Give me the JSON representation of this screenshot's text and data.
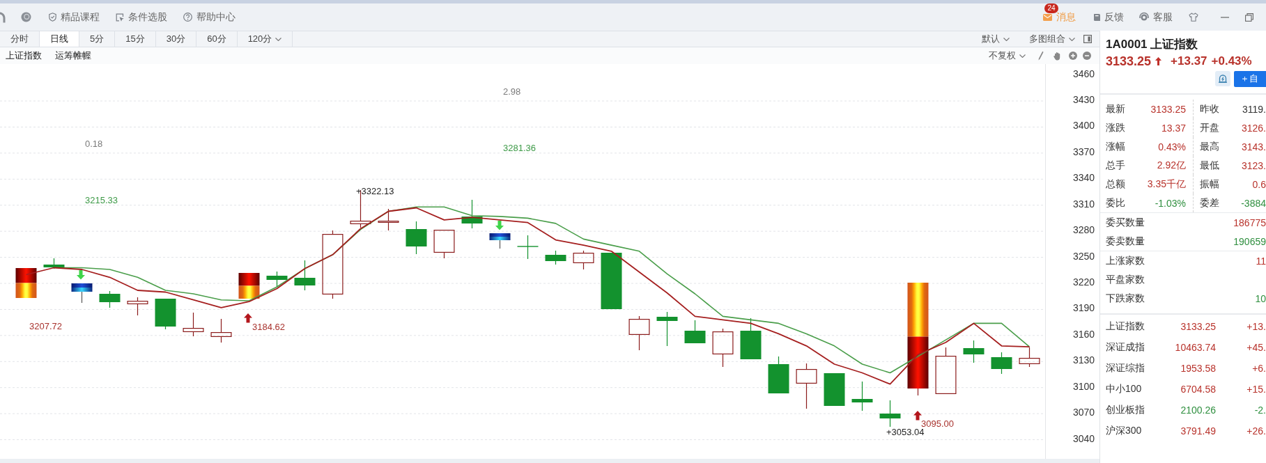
{
  "title_bar": {
    "links": [
      {
        "label": "精品课程"
      },
      {
        "label": "条件选股"
      },
      {
        "label": "帮助中心"
      }
    ],
    "messages": {
      "label": "消息",
      "badge": "24"
    },
    "actions": [
      {
        "label": "反馈"
      },
      {
        "label": "客服"
      }
    ]
  },
  "period_tabs": [
    {
      "label": "分时",
      "selected": false,
      "kind": "tab"
    },
    {
      "label": "日线",
      "selected": true,
      "kind": "tab"
    },
    {
      "label": "5分",
      "selected": false,
      "kind": "tab"
    },
    {
      "label": "15分",
      "selected": false,
      "kind": "tab"
    },
    {
      "label": "30分",
      "selected": false,
      "kind": "tab"
    },
    {
      "label": "60分",
      "selected": false,
      "kind": "tab"
    },
    {
      "label": "120分",
      "selected": false,
      "kind": "dropdown"
    }
  ],
  "view_options": [
    {
      "label": "默认"
    },
    {
      "label": "多图组合"
    }
  ],
  "indicator_bar": {
    "labels": [
      "上证指数",
      "运筹帷幄"
    ],
    "adjustment": "不复权"
  },
  "chart": {
    "chart_data": {
      "type": "line",
      "ylim": [
        3018,
        3472.5
      ],
      "yticks": [
        3460,
        3430,
        3400,
        3370,
        3340,
        3310,
        3280,
        3250,
        3220,
        3190,
        3160,
        3130,
        3100,
        3070,
        3040
      ],
      "grid": true,
      "series": [
        {
          "color": "#a51f1f",
          "values": [
            3230,
            3238,
            3236,
            3227,
            3212,
            3210,
            3201,
            3192,
            3199,
            3214,
            3237,
            3253,
            3283,
            3303,
            3307,
            3293,
            3296,
            3293,
            3290,
            3270,
            3264,
            3257,
            3233,
            3209,
            3182,
            3178,
            3174,
            3162,
            3148,
            3127,
            3117,
            3104,
            3138,
            3152,
            3174,
            3148,
            3147
          ]
        },
        {
          "color": "#4a9e4a",
          "values": [
            null,
            3238,
            3238,
            3236,
            3227,
            3212,
            3208,
            3201,
            3200,
            3216,
            3237,
            3253,
            3282,
            3303,
            3308,
            3308,
            3298,
            3297,
            3295,
            3289,
            3271,
            3264,
            3257,
            3231,
            3208,
            3182,
            3178,
            3174,
            3162,
            3148,
            3127,
            3117,
            3136,
            3155,
            3174,
            3174,
            3147
          ]
        }
      ]
    },
    "labels": [
      {
        "text": "2.98",
        "kind": "indicator"
      },
      {
        "text": "0.18",
        "kind": "indicator"
      },
      {
        "text": "3281.36",
        "kind": "level"
      },
      {
        "text": "+3322.13",
        "kind": "extreme"
      },
      {
        "text": "3215.33",
        "kind": "level"
      },
      {
        "text": "3207.72",
        "kind": "signal"
      },
      {
        "text": "3184.62",
        "kind": "signal"
      },
      {
        "text": "3095.00",
        "kind": "signal"
      },
      {
        "text": "+3053.04",
        "kind": "extreme"
      }
    ]
  },
  "quote_panel": {
    "title": "1A0001 上证指数",
    "price": "3133.25",
    "rising": true,
    "change": "+13.37",
    "change_percent": "+0.43%",
    "add_button": "＋自",
    "stats": [
      {
        "label": "最新",
        "value": "3133.25",
        "color": "#b8322b"
      },
      {
        "label": "昨收",
        "value": "3119.",
        "color": "#333333"
      },
      {
        "label": "涨跌",
        "value": "13.37",
        "color": "#b8322b"
      },
      {
        "label": "开盘",
        "value": "3126.",
        "color": "#b8322b"
      },
      {
        "label": "涨幅",
        "value": "0.43%",
        "color": "#b8322b"
      },
      {
        "label": "最高",
        "value": "3143.",
        "color": "#b8322b"
      },
      {
        "label": "总手",
        "value": "2.92亿",
        "color": "#b8322b"
      },
      {
        "label": "最低",
        "value": "3123.",
        "color": "#b8322b"
      },
      {
        "label": "总额",
        "value": "3.35千亿",
        "color": "#b8322b"
      },
      {
        "label": "振幅",
        "value": "0.6",
        "color": "#b8322b"
      },
      {
        "label": "委比",
        "value": "-1.03%",
        "color": "#2f8f3f"
      },
      {
        "label": "委差",
        "value": "-3884",
        "color": "#2f8f3f"
      }
    ],
    "orders": [
      {
        "label": "委买数量",
        "value": "186775",
        "color": "#b8322b"
      },
      {
        "label": "委卖数量",
        "value": "190659",
        "color": "#2f8f3f"
      }
    ],
    "breadth": [
      {
        "label": "上涨家数",
        "value": "11",
        "color": "#b8322b"
      },
      {
        "label": "平盘家数"
      },
      {
        "label": "下跌家数",
        "value": "10",
        "color": "#2f8f3f"
      }
    ],
    "indices": [
      {
        "name": "上证指数",
        "value": "3133.25",
        "change": "+13.",
        "color": "#b8322b"
      },
      {
        "name": "深证成指",
        "value": "10463.74",
        "change": "+45.",
        "color": "#b8322b"
      },
      {
        "name": "深证综指",
        "value": "1953.58",
        "change": "+6.",
        "color": "#b8322b"
      },
      {
        "name": "中小100",
        "value": "6704.58",
        "change": "+15.",
        "color": "#b8322b"
      },
      {
        "name": "创业板指",
        "value": "2100.26",
        "change": "-2.",
        "color": "#2f8f3f"
      },
      {
        "name": "沪深300",
        "value": "3791.49",
        "change": "+26.",
        "color": "#b8322b"
      }
    ]
  }
}
